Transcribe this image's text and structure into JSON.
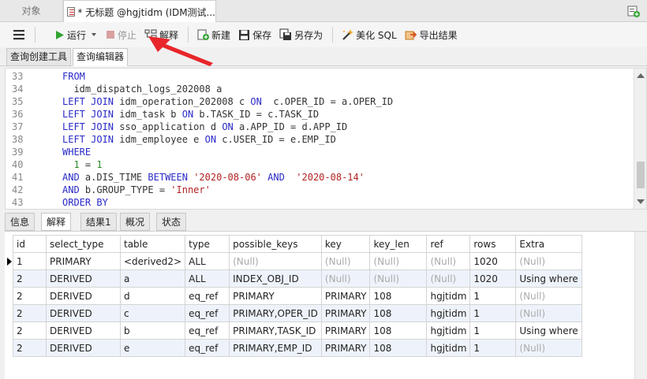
{
  "tabs": {
    "objects": "对象",
    "query": "* 无标题 @hgjtidm (IDM测试..."
  },
  "toolbar": {
    "run": "运行",
    "stop": "停止",
    "explain": "解释",
    "new": "新建",
    "save": "保存",
    "save_as": "另存为",
    "beautify": "美化 SQL",
    "export": "导出结果"
  },
  "subtabs": [
    "查询创建工具",
    "查询编辑器"
  ],
  "editor": {
    "lines": [
      {
        "n": "33",
        "html": "<span class='kw'>FROM</span>"
      },
      {
        "n": "34",
        "html": "  idm_dispatch_logs_202008 a"
      },
      {
        "n": "35",
        "html": "<span class='kw'>LEFT JOIN</span> idm_operation_202008 c <span class='kw'>ON</span>  c.OPER_ID = a.OPER_ID"
      },
      {
        "n": "36",
        "html": "<span class='kw'>LEFT JOIN</span> idm_task b <span class='kw'>ON</span> b.TASK_ID = c.TASK_ID"
      },
      {
        "n": "37",
        "html": "<span class='kw'>LEFT JOIN</span> sso_application d <span class='kw'>ON</span> a.APP_ID = d.APP_ID"
      },
      {
        "n": "38",
        "html": "<span class='kw'>LEFT JOIN</span> idm_employee e <span class='kw'>ON</span> c.USER_ID = e.EMP_ID"
      },
      {
        "n": "39",
        "html": "<span class='kw'>WHERE</span>"
      },
      {
        "n": "40",
        "html": "  <span class='num'>1</span> = <span class='num'>1</span>"
      },
      {
        "n": "41",
        "html": "<span class='kw'>AND</span> a.DIS_TIME <span class='kw'>BETWEEN</span> <span class='str'>'2020-08-06'</span> <span class='kw'>AND</span>  <span class='str'>'2020-08-14'</span>"
      },
      {
        "n": "42",
        "html": "<span class='kw'>AND</span> b.GROUP_TYPE = <span class='str'>'Inner'</span>"
      },
      {
        "n": "43",
        "html": "<span class='kw'>ORDER BY</span>"
      }
    ]
  },
  "result_tabs": [
    "信息",
    "解释",
    "结果1",
    "概况",
    "状态"
  ],
  "grid": {
    "columns": [
      "id",
      "select_type",
      "table",
      "type",
      "possible_keys",
      "key",
      "key_len",
      "ref",
      "rows",
      "Extra"
    ],
    "rows": [
      [
        "1",
        "PRIMARY",
        "<derived2>",
        "ALL",
        "(Null)",
        "(Null)",
        "(Null)",
        "(Null)",
        "1020",
        "(Null)"
      ],
      [
        "2",
        "DERIVED",
        "a",
        "ALL",
        "INDEX_OBJ_ID",
        "(Null)",
        "(Null)",
        "(Null)",
        "1020",
        "Using where"
      ],
      [
        "2",
        "DERIVED",
        "d",
        "eq_ref",
        "PRIMARY",
        "PRIMARY",
        "108",
        "hgjtidm",
        "1",
        "(Null)"
      ],
      [
        "2",
        "DERIVED",
        "c",
        "eq_ref",
        "PRIMARY,OPER_ID",
        "PRIMARY",
        "108",
        "hgjtidm",
        "1",
        "(Null)"
      ],
      [
        "2",
        "DERIVED",
        "b",
        "eq_ref",
        "PRIMARY,TASK_ID",
        "PRIMARY",
        "108",
        "hgjtidm",
        "1",
        "Using where"
      ],
      [
        "2",
        "DERIVED",
        "e",
        "eq_ref",
        "PRIMARY,EMP_ID",
        "PRIMARY",
        "108",
        "hgjtidm",
        "1",
        "(Null)"
      ]
    ]
  },
  "colors": {
    "keyword": "#2929c8",
    "string": "#b22222",
    "number": "#2a8a2a",
    "annotation_arrow": "#e8262a",
    "run_icon": "#2fa32f",
    "stop_icon": "#d9a0a0"
  }
}
